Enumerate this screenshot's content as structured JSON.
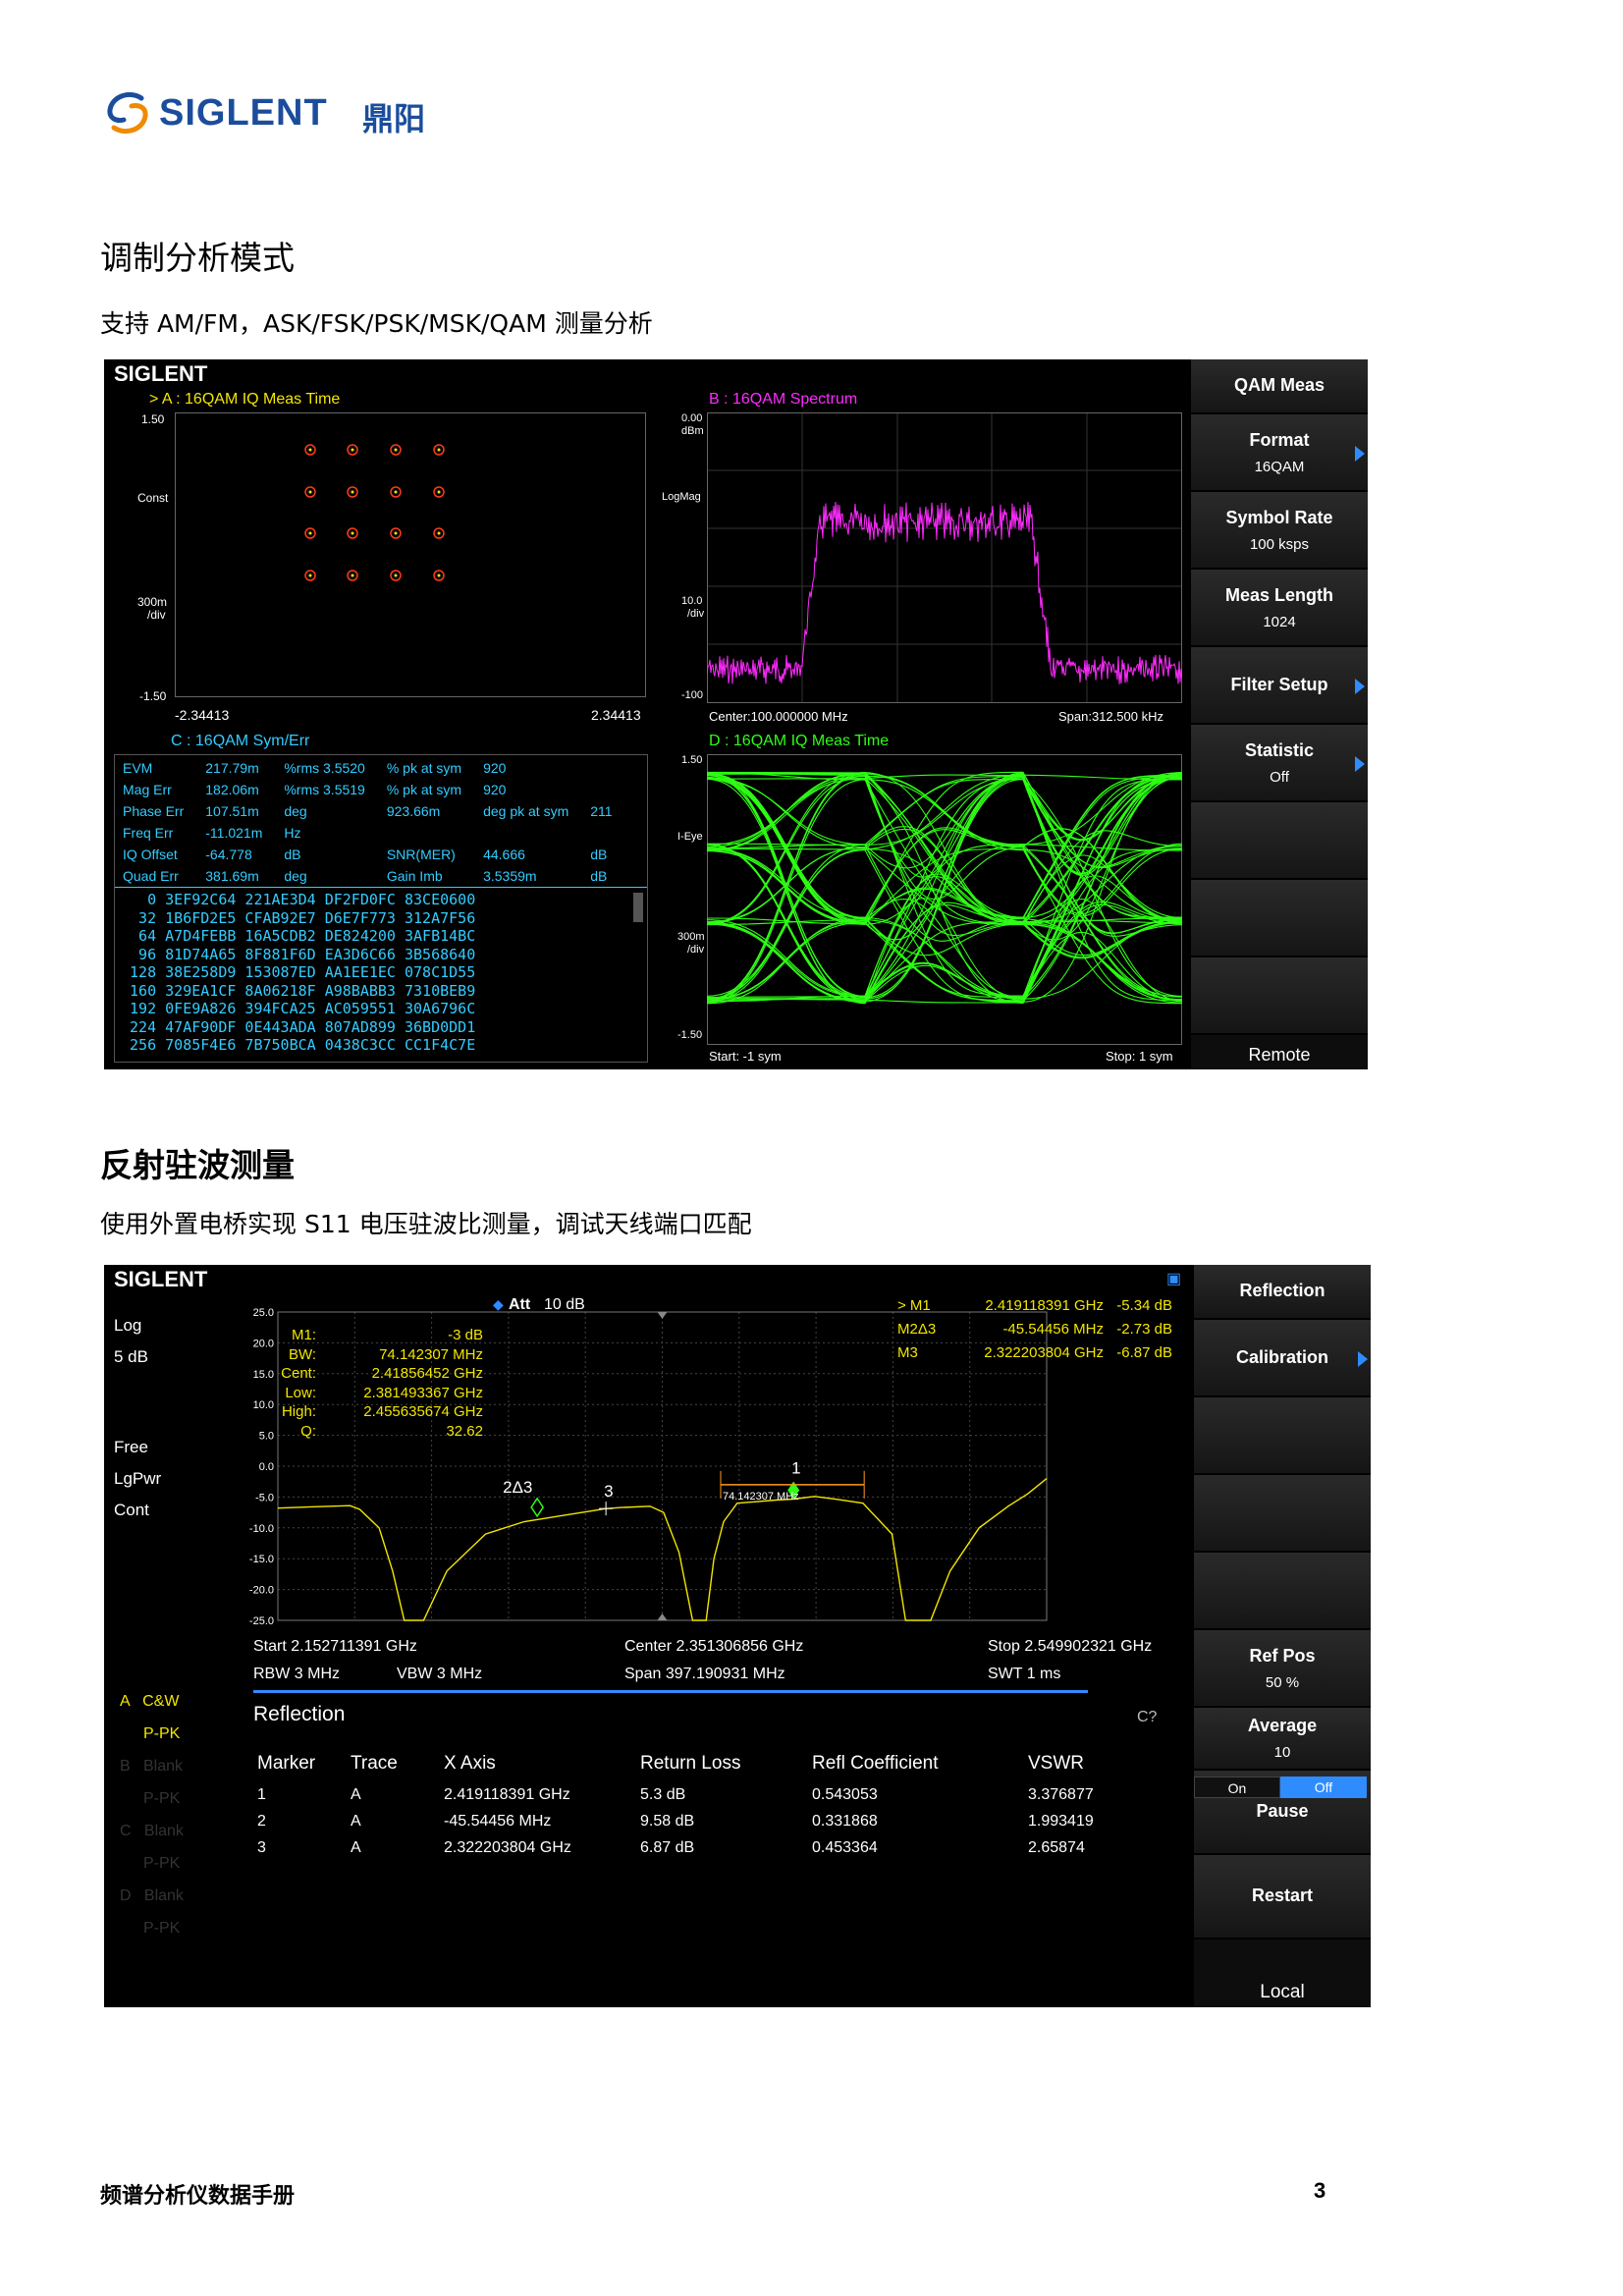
{
  "logo": {
    "brand": "SIGLENT",
    "suffix": "鼎阳"
  },
  "section1": {
    "title": "调制分析模式",
    "desc": "支持 AM/FM，ASK/FSK/PSK/MSK/QAM 测量分析"
  },
  "section2": {
    "title": "反射驻波测量",
    "desc": "使用外置电桥实现 S11 电压驻波比测量，调试天线端口匹配"
  },
  "footer": {
    "title": "频谱分析仪数据手册",
    "page": "3"
  },
  "qam": {
    "brand": "SIGLENT",
    "panelA": {
      "title": "> A :  16QAM  IQ Meas Time",
      "ytop": "1.50",
      "ymid": "Const",
      "ydiv1": "300m",
      "ydiv2": "/div",
      "ybot": "-1.50",
      "xleft": "-2.34413",
      "xright": "2.34413"
    },
    "panelB": {
      "title": "B :  16QAM  Spectrum",
      "ytop1": "0.00",
      "ytop2": "dBm",
      "ymid": "LogMag",
      "ydiv1": "10.0",
      "ydiv2": "/div",
      "ybot": "-100",
      "xleft": "Center:100.000000 MHz",
      "xright": "Span:312.500 kHz"
    },
    "panelC": {
      "title": "C :  16QAM  Sym/Err",
      "rows": [
        [
          "EVM",
          "217.79m",
          "%rms 3.5520",
          "% pk at sym",
          "920"
        ],
        [
          "Mag Err",
          "182.06m",
          "%rms 3.5519",
          "% pk at sym",
          "920"
        ],
        [
          "Phase Err",
          "107.51m",
          "deg",
          "923.66m",
          "deg pk at sym",
          "211"
        ],
        [
          "Freq Err",
          "-11.021m",
          "Hz"
        ],
        [
          "IQ Offset",
          "-64.778",
          "dB",
          "SNR(MER)",
          "44.666",
          "dB"
        ],
        [
          "Quad Err",
          "381.69m",
          "deg",
          "Gain Imb",
          "3.5359m",
          "dB"
        ]
      ],
      "hex": [
        [
          "0",
          "3EF92C64",
          "221AE3D4",
          "DF2FD0FC",
          "83CE0600"
        ],
        [
          "32",
          "1B6FD2E5",
          "CFAB92E7",
          "D6E7F773",
          "312A7F56"
        ],
        [
          "64",
          "A7D4FEBB",
          "16A5CDB2",
          "DE824200",
          "3AFB14BC"
        ],
        [
          "96",
          "81D74A65",
          "8F881F6D",
          "EA3D6C66",
          "3B568640"
        ],
        [
          "128",
          "38E258D9",
          "153087ED",
          "AA1EE1EC",
          "078C1D55"
        ],
        [
          "160",
          "329EA1CF",
          "8A06218F",
          "A98BABB3",
          "7310BEB9"
        ],
        [
          "192",
          "0FE9A826",
          "394FCA25",
          "AC059551",
          "30A6796C"
        ],
        [
          "224",
          "47AF90DF",
          "0E443ADA",
          "807AD899",
          "36BD0DD1"
        ],
        [
          "256",
          "7085F4E6",
          "7B750BCA",
          "0438C3CC",
          "CC1F4C7E"
        ]
      ]
    },
    "panelD": {
      "title": "D :  16QAM  IQ Meas Time",
      "ytop": "1.50",
      "ymid": "I-Eye",
      "ydiv1": "300m",
      "ydiv2": "/div",
      "ybot": "-1.50",
      "xleft": "Start: -1 sym",
      "xright": "Stop: 1 sym"
    },
    "softkeys": [
      {
        "label": "QAM Meas",
        "value": ""
      },
      {
        "label": "Format",
        "value": "16QAM",
        "arrow": true
      },
      {
        "label": "Symbol Rate",
        "value": "100 ksps"
      },
      {
        "label": "Meas Length",
        "value": "1024"
      },
      {
        "label": "Filter Setup",
        "value": "",
        "arrow": true
      },
      {
        "label": "Statistic",
        "value": "Off",
        "arrow": true
      },
      {
        "label": "",
        "value": ""
      },
      {
        "label": "",
        "value": ""
      },
      {
        "label": "",
        "value": ""
      }
    ],
    "status": "Remote"
  },
  "refl": {
    "brand": "SIGLENT",
    "att": "Att",
    "att_val": "10 dB",
    "left": {
      "scale1": "Log",
      "scale2": "5 dB",
      "mode1": "Free",
      "mode2": "LgPwr",
      "mode3": "Cont"
    },
    "yticks": [
      "25.0",
      "20.0",
      "15.0",
      "10.0",
      "5.0",
      "0.0",
      "-5.0",
      "-10.0",
      "-15.0",
      "-20.0",
      "-25.0"
    ],
    "box": [
      [
        "M1:",
        "-3 dB"
      ],
      [
        "BW:",
        "74.142307 MHz"
      ],
      [
        "Cent:",
        "2.41856452 GHz"
      ],
      [
        "Low:",
        "2.381493367 GHz"
      ],
      [
        "High:",
        "2.455635674 GHz"
      ],
      [
        "Q:",
        "32.62"
      ]
    ],
    "markers_readout": [
      [
        "> M1",
        "2.419118391 GHz",
        "-5.34 dB"
      ],
      [
        "M2Δ3",
        "-45.54456 MHz",
        "-2.73 dB"
      ],
      [
        "M3",
        "2.322203804 GHz",
        "-6.87 dB"
      ]
    ],
    "mk": {
      "m1": "1",
      "m2": "2Δ3",
      "m3": "3",
      "bw": "74.142307 MHz"
    },
    "bottom": {
      "start": "Start  2.152711391 GHz",
      "center": "Center  2.351306856 GHz",
      "stop": "Stop  2.549902321 GHz",
      "rbw": "RBW  3 MHz",
      "vbw": "VBW  3 MHz",
      "span": "Span    397.190931 MHz",
      "swt": "SWT   1 ms"
    },
    "traces": [
      [
        "A",
        "C&W",
        "P-PK"
      ],
      [
        "B",
        "Blank",
        "P-PK"
      ],
      [
        "C",
        "Blank",
        "P-PK"
      ],
      [
        "D",
        "Blank",
        "P-PK"
      ]
    ],
    "table": {
      "title": "Reflection",
      "cq": "C?",
      "headers": [
        "Marker",
        "Trace",
        "X Axis",
        "Return Loss",
        "Refl Coefficient",
        "VSWR"
      ],
      "rows": [
        [
          "1",
          "A",
          "2.419118391 GHz",
          "5.3 dB",
          "0.543053",
          "3.376877"
        ],
        [
          "2",
          "A",
          "-45.54456 MHz",
          "9.58 dB",
          "0.331868",
          "1.993419"
        ],
        [
          "3",
          "A",
          "2.322203804 GHz",
          "6.87 dB",
          "0.453364",
          "2.65874"
        ]
      ]
    },
    "softkeys": [
      {
        "label": "Reflection",
        "value": ""
      },
      {
        "label": "Calibration",
        "value": "",
        "arrow": true
      },
      {
        "label": "",
        "value": ""
      },
      {
        "label": "",
        "value": ""
      },
      {
        "label": "",
        "value": ""
      },
      {
        "label": "Ref Pos",
        "value": "50 %"
      },
      {
        "label": "Average",
        "value": "10"
      },
      {
        "label": "Pause",
        "value": ""
      },
      {
        "label": "Restart",
        "value": ""
      }
    ],
    "toggle": {
      "on": "On",
      "off": "Off"
    },
    "status": "Local"
  },
  "colors": {
    "yellow": "#f2e600",
    "magenta": "#ff2bff",
    "green": "#2eff14",
    "cyan": "#33ccff",
    "orange": "#ff9a1a",
    "blue": "#2f8cff"
  }
}
